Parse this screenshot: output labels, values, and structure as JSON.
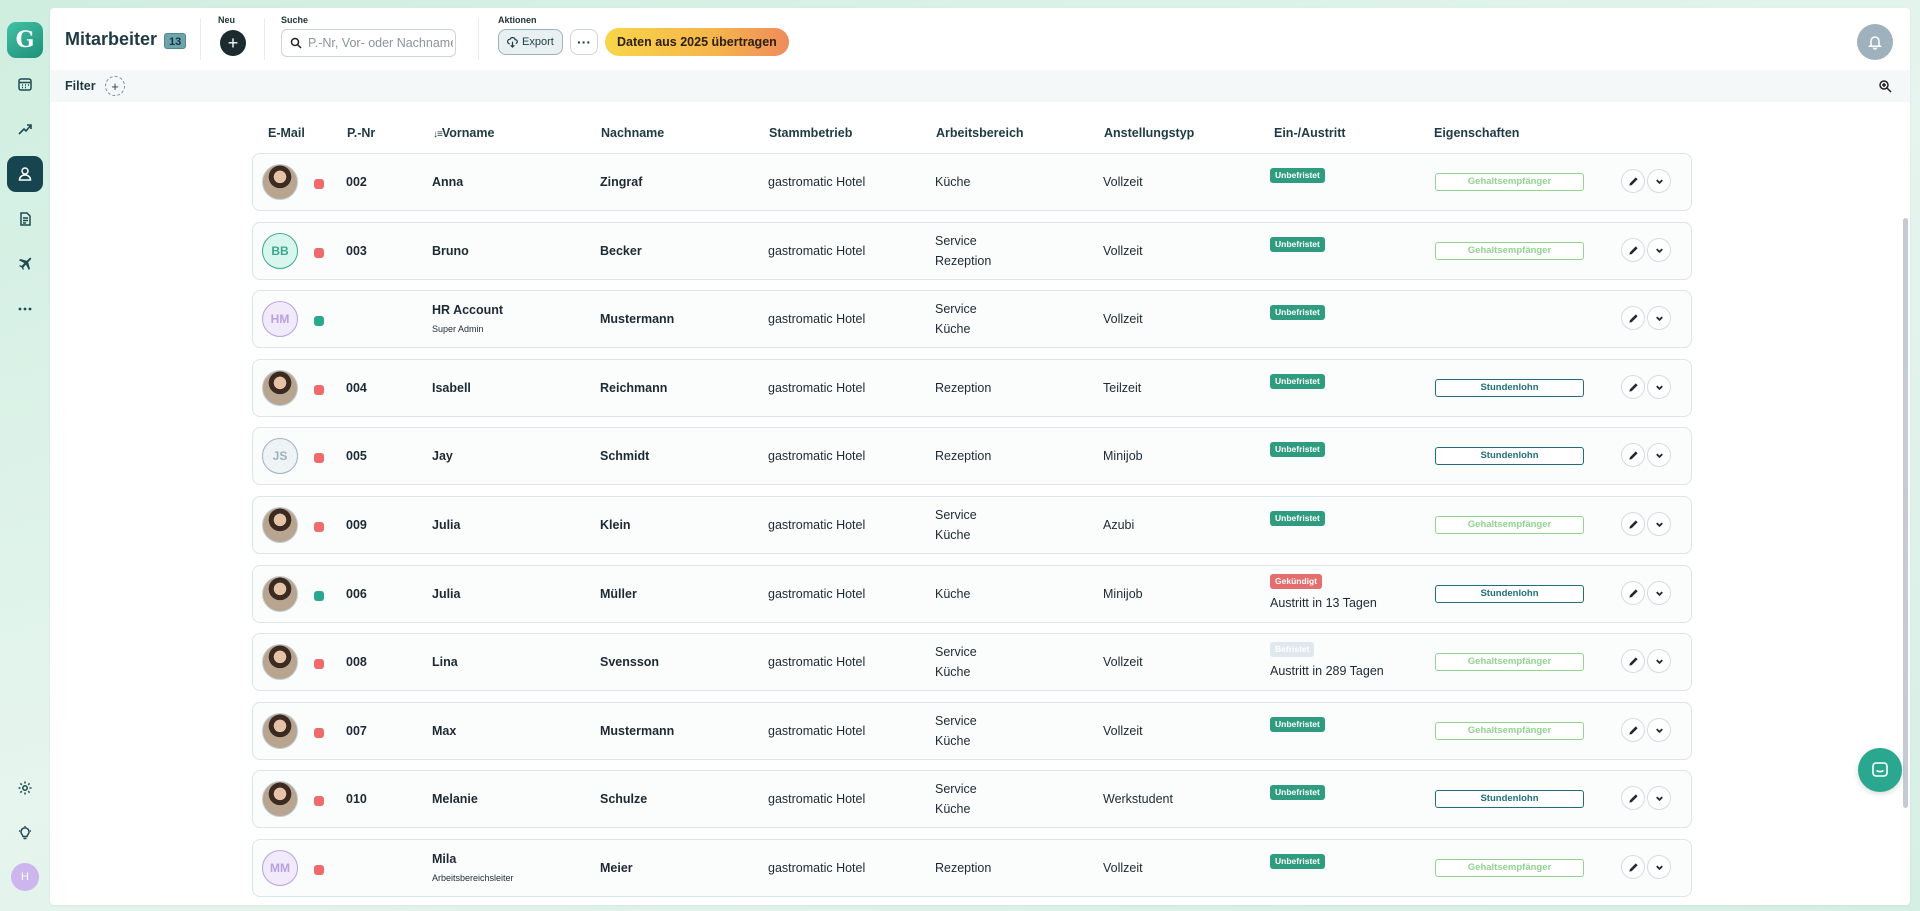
{
  "app": {
    "logo_letter": "G"
  },
  "sidebar": {
    "items": [
      {
        "icon": "calendar-icon",
        "name": "sidebar-item-calendar"
      },
      {
        "icon": "trend-icon",
        "name": "sidebar-item-reports"
      },
      {
        "icon": "person-icon",
        "name": "sidebar-item-employees"
      },
      {
        "icon": "document-icon",
        "name": "sidebar-item-documents"
      },
      {
        "icon": "plane-icon",
        "name": "sidebar-item-absences"
      },
      {
        "icon": "more-icon",
        "name": "sidebar-item-more"
      }
    ],
    "user_initial": "H"
  },
  "header": {
    "title": "Mitarbeiter",
    "count": "13",
    "new_label": "Neu",
    "search_label": "Suche",
    "search_placeholder": "P.-Nr, Vor- oder Nachname",
    "actions_label": "Aktionen",
    "export_label": "Export",
    "more_label": "···",
    "transfer_label": "Daten aus 2025 übertragen"
  },
  "filter": {
    "label": "Filter",
    "add_label": "+"
  },
  "table": {
    "columns": [
      "E-Mail",
      "P.-Nr",
      "Vorname",
      "Nachname",
      "Stammbetrieb",
      "Arbeitsbereich",
      "Anstellungstyp",
      "Ein-/Austritt",
      "Eigenschaften"
    ],
    "sort_icon": "↓≡",
    "rows": [
      {
        "initials": "",
        "photo": true,
        "status": "red",
        "pnr": "002",
        "first": "Anna",
        "sub": "",
        "last": "Zingraf",
        "site": "gastromatic Hotel",
        "area": [
          "Küche"
        ],
        "type": "Vollzeit",
        "badge": "Unbefristet",
        "badge_kind": "green",
        "exit": "",
        "tag": "Gehaltsempfänger",
        "tag_kind": "light"
      },
      {
        "initials": "BB",
        "photo": false,
        "avatar_bg": "#d9f6ee",
        "avatar_fg": "#3aa88c",
        "status": "red",
        "pnr": "003",
        "first": "Bruno",
        "sub": "",
        "last": "Becker",
        "site": "gastromatic Hotel",
        "area": [
          "Service",
          "Rezeption"
        ],
        "type": "Vollzeit",
        "badge": "Unbefristet",
        "badge_kind": "green",
        "exit": "",
        "tag": "Gehaltsempfänger",
        "tag_kind": "light"
      },
      {
        "initials": "HM",
        "photo": false,
        "avatar_bg": "#f0eafb",
        "avatar_fg": "#b9a1e0",
        "status": "green",
        "pnr": "",
        "first": "HR Account",
        "sub": "Super Admin",
        "last": "Mustermann",
        "site": "gastromatic Hotel",
        "area": [
          "Service",
          "Küche"
        ],
        "type": "Vollzeit",
        "badge": "Unbefristet",
        "badge_kind": "green",
        "exit": "",
        "tag": "",
        "tag_kind": ""
      },
      {
        "initials": "",
        "photo": true,
        "status": "red",
        "pnr": "004",
        "first": "Isabell",
        "sub": "",
        "last": "Reichmann",
        "site": "gastromatic Hotel",
        "area": [
          "Rezeption"
        ],
        "type": "Teilzeit",
        "badge": "Unbefristet",
        "badge_kind": "green",
        "exit": "",
        "tag": "Stundenlohn",
        "tag_kind": "dark"
      },
      {
        "initials": "JS",
        "photo": false,
        "avatar_bg": "#eef3f6",
        "avatar_fg": "#9fb0ba",
        "status": "red",
        "pnr": "005",
        "first": "Jay",
        "sub": "",
        "last": "Schmidt",
        "site": "gastromatic Hotel",
        "area": [
          "Rezeption"
        ],
        "type": "Minijob",
        "badge": "Unbefristet",
        "badge_kind": "green",
        "exit": "",
        "tag": "Stundenlohn",
        "tag_kind": "dark"
      },
      {
        "initials": "",
        "photo": true,
        "status": "red",
        "pnr": "009",
        "first": "Julia",
        "sub": "",
        "last": "Klein",
        "site": "gastromatic Hotel",
        "area": [
          "Service",
          "Küche"
        ],
        "type": "Azubi",
        "badge": "Unbefristet",
        "badge_kind": "green",
        "exit": "",
        "tag": "Gehaltsempfänger",
        "tag_kind": "light"
      },
      {
        "initials": "",
        "photo": true,
        "status": "green",
        "pnr": "006",
        "first": "Julia",
        "sub": "",
        "last": "Müller",
        "site": "gastromatic Hotel",
        "area": [
          "Küche"
        ],
        "type": "Minijob",
        "badge": "Gekündigt",
        "badge_kind": "red",
        "exit": "Austritt in 13 Tagen",
        "tag": "Stundenlohn",
        "tag_kind": "dark"
      },
      {
        "initials": "",
        "photo": true,
        "status": "red",
        "pnr": "008",
        "first": "Lina",
        "sub": "",
        "last": "Svensson",
        "site": "gastromatic Hotel",
        "area": [
          "Service",
          "Küche"
        ],
        "type": "Vollzeit",
        "badge": "Befristet",
        "badge_kind": "faint",
        "exit": "Austritt in 289 Tagen",
        "tag": "Gehaltsempfänger",
        "tag_kind": "light"
      },
      {
        "initials": "",
        "photo": true,
        "status": "red",
        "pnr": "007",
        "first": "Max",
        "sub": "",
        "last": "Mustermann",
        "site": "gastromatic Hotel",
        "area": [
          "Service",
          "Küche"
        ],
        "type": "Vollzeit",
        "badge": "Unbefristet",
        "badge_kind": "green",
        "exit": "",
        "tag": "Gehaltsempfänger",
        "tag_kind": "light"
      },
      {
        "initials": "",
        "photo": true,
        "status": "red",
        "pnr": "010",
        "first": "Melanie",
        "sub": "",
        "last": "Schulze",
        "site": "gastromatic Hotel",
        "area": [
          "Service",
          "Küche"
        ],
        "type": "Werkstudent",
        "badge": "Unbefristet",
        "badge_kind": "green",
        "exit": "",
        "tag": "Stundenlohn",
        "tag_kind": "dark"
      },
      {
        "initials": "MM",
        "photo": false,
        "avatar_bg": "#f0eafb",
        "avatar_fg": "#b9a1e0",
        "status": "red",
        "pnr": "",
        "first": "Mila",
        "sub": "Arbeitsbereichsleiter",
        "last": "Meier",
        "site": "gastromatic Hotel",
        "area": [
          "Rezeption"
        ],
        "type": "Vollzeit",
        "badge": "Unbefristet",
        "badge_kind": "green",
        "exit": "",
        "tag": "Gehaltsempfänger",
        "tag_kind": "light"
      }
    ]
  },
  "colors": {
    "status_red": "#ef6b6b",
    "status_green": "#2aa88f",
    "badge_green": "#2f9c80",
    "badge_red": "#e56d6d",
    "badge_faint": "#dfe8ee",
    "tag_light": "#8fd48f",
    "tag_dark": "#1f6f7a"
  }
}
